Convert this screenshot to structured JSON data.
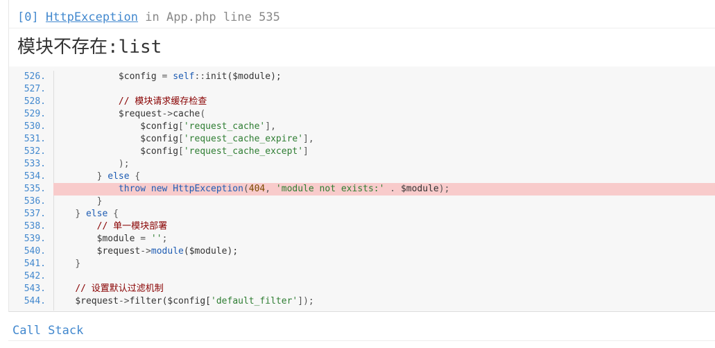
{
  "exception": {
    "index": "[0]",
    "class_name": "HttpException",
    "in_word": "in",
    "file": "App.php",
    "line_word": "line",
    "line_number": "535",
    "message": "模块不存在:list"
  },
  "source_lines": [
    {
      "no": "526.",
      "tokens": [
        {
          "t": "            ",
          "c": "v"
        },
        {
          "t": "$config",
          "c": "v"
        },
        {
          "t": " = ",
          "c": "p"
        },
        {
          "t": "self",
          "c": "k"
        },
        {
          "t": "::",
          "c": "p"
        },
        {
          "t": "init",
          "c": "v"
        },
        {
          "t": "($module);",
          "c": "v"
        }
      ]
    },
    {
      "no": "527.",
      "tokens": []
    },
    {
      "no": "528.",
      "tokens": [
        {
          "t": "            ",
          "c": "v"
        },
        {
          "t": "// 模块请求缓存检查",
          "c": "c"
        }
      ]
    },
    {
      "no": "529.",
      "tokens": [
        {
          "t": "            ",
          "c": "v"
        },
        {
          "t": "$request",
          "c": "v"
        },
        {
          "t": "->",
          "c": "p"
        },
        {
          "t": "cache",
          "c": "v"
        },
        {
          "t": "(",
          "c": "p"
        }
      ]
    },
    {
      "no": "530.",
      "tokens": [
        {
          "t": "                ",
          "c": "v"
        },
        {
          "t": "$config",
          "c": "v"
        },
        {
          "t": "[",
          "c": "p"
        },
        {
          "t": "'request_cache'",
          "c": "s"
        },
        {
          "t": "],",
          "c": "p"
        }
      ]
    },
    {
      "no": "531.",
      "tokens": [
        {
          "t": "                ",
          "c": "v"
        },
        {
          "t": "$config",
          "c": "v"
        },
        {
          "t": "[",
          "c": "p"
        },
        {
          "t": "'request_cache_expire'",
          "c": "s"
        },
        {
          "t": "],",
          "c": "p"
        }
      ]
    },
    {
      "no": "532.",
      "tokens": [
        {
          "t": "                ",
          "c": "v"
        },
        {
          "t": "$config",
          "c": "v"
        },
        {
          "t": "[",
          "c": "p"
        },
        {
          "t": "'request_cache_except'",
          "c": "s"
        },
        {
          "t": "]",
          "c": "p"
        }
      ]
    },
    {
      "no": "533.",
      "tokens": [
        {
          "t": "            ",
          "c": "v"
        },
        {
          "t": ");",
          "c": "p"
        }
      ]
    },
    {
      "no": "534.",
      "tokens": [
        {
          "t": "        ",
          "c": "v"
        },
        {
          "t": "} ",
          "c": "p"
        },
        {
          "t": "else",
          "c": "k"
        },
        {
          "t": " {",
          "c": "p"
        }
      ]
    },
    {
      "no": "535.",
      "highlight": true,
      "tokens": [
        {
          "t": "            ",
          "c": "v"
        },
        {
          "t": "throw",
          "c": "k"
        },
        {
          "t": " ",
          "c": "p"
        },
        {
          "t": "new",
          "c": "k"
        },
        {
          "t": " ",
          "c": "p"
        },
        {
          "t": "HttpException",
          "c": "f"
        },
        {
          "t": "(",
          "c": "p"
        },
        {
          "t": "404",
          "c": "n"
        },
        {
          "t": ", ",
          "c": "p"
        },
        {
          "t": "'module not exists:'",
          "c": "s"
        },
        {
          "t": " . ",
          "c": "p"
        },
        {
          "t": "$module",
          "c": "v"
        },
        {
          "t": ");",
          "c": "p"
        }
      ]
    },
    {
      "no": "536.",
      "tokens": [
        {
          "t": "        ",
          "c": "v"
        },
        {
          "t": "}",
          "c": "p"
        }
      ]
    },
    {
      "no": "537.",
      "tokens": [
        {
          "t": "    ",
          "c": "v"
        },
        {
          "t": "} ",
          "c": "p"
        },
        {
          "t": "else",
          "c": "k"
        },
        {
          "t": " {",
          "c": "p"
        }
      ]
    },
    {
      "no": "538.",
      "tokens": [
        {
          "t": "        ",
          "c": "v"
        },
        {
          "t": "// 单一模块部署",
          "c": "c"
        }
      ]
    },
    {
      "no": "539.",
      "tokens": [
        {
          "t": "        ",
          "c": "v"
        },
        {
          "t": "$module",
          "c": "v"
        },
        {
          "t": " = ",
          "c": "p"
        },
        {
          "t": "''",
          "c": "s"
        },
        {
          "t": ";",
          "c": "p"
        }
      ]
    },
    {
      "no": "540.",
      "tokens": [
        {
          "t": "        ",
          "c": "v"
        },
        {
          "t": "$request",
          "c": "v"
        },
        {
          "t": "->",
          "c": "p"
        },
        {
          "t": "module",
          "c": "f"
        },
        {
          "t": "($module);",
          "c": "v"
        }
      ]
    },
    {
      "no": "541.",
      "tokens": [
        {
          "t": "    ",
          "c": "v"
        },
        {
          "t": "}",
          "c": "p"
        }
      ]
    },
    {
      "no": "542.",
      "tokens": []
    },
    {
      "no": "543.",
      "tokens": [
        {
          "t": "    ",
          "c": "v"
        },
        {
          "t": "// 设置默认过滤机制",
          "c": "c"
        }
      ]
    },
    {
      "no": "544.",
      "tokens": [
        {
          "t": "    ",
          "c": "v"
        },
        {
          "t": "$request",
          "c": "v"
        },
        {
          "t": "->",
          "c": "p"
        },
        {
          "t": "filter",
          "c": "v"
        },
        {
          "t": "($config[",
          "c": "v"
        },
        {
          "t": "'default_filter'",
          "c": "s"
        },
        {
          "t": "]);",
          "c": "p"
        }
      ]
    }
  ],
  "call_stack": {
    "heading": "Call Stack"
  }
}
